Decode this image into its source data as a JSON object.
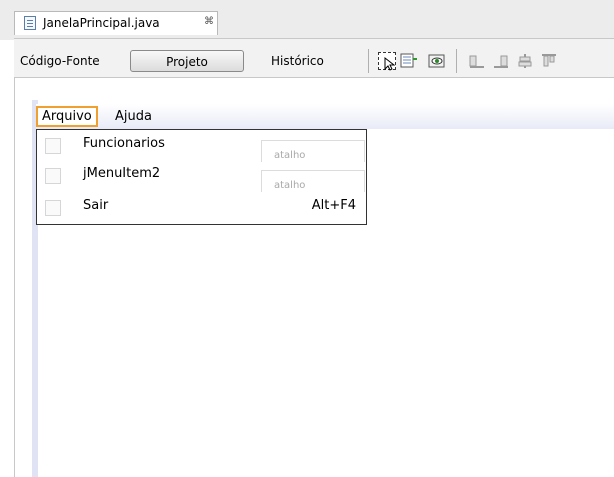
{
  "editor_tab": {
    "title": "JanelaPrincipal.java",
    "close_glyph": "⌘",
    "icon": "java-file-icon"
  },
  "toolbar": {
    "source_label": "Código-Fonte",
    "design_label": "Projeto",
    "history_label": "Histórico",
    "icons": [
      "selection-mode-icon",
      "connection-mode-icon",
      "preview-design-icon",
      "align-left-icon",
      "align-right-icon",
      "center-horizontal-icon",
      "align-top-icon"
    ]
  },
  "menubar": {
    "items": [
      {
        "label": "Arquivo",
        "selected": true
      },
      {
        "label": "Ajuda",
        "selected": false
      }
    ]
  },
  "dropdown": {
    "items": [
      {
        "label": "Funcionarios",
        "shortcut_placeholder": "atalho",
        "accelerator": ""
      },
      {
        "label": "jMenuItem2",
        "shortcut_placeholder": "atalho",
        "accelerator": ""
      },
      {
        "label": "Sair",
        "shortcut_placeholder": "",
        "accelerator": "Alt+F4"
      }
    ]
  },
  "colors": {
    "selection_border": "#f0a030",
    "canvas_tint": "#dfe3f3"
  }
}
